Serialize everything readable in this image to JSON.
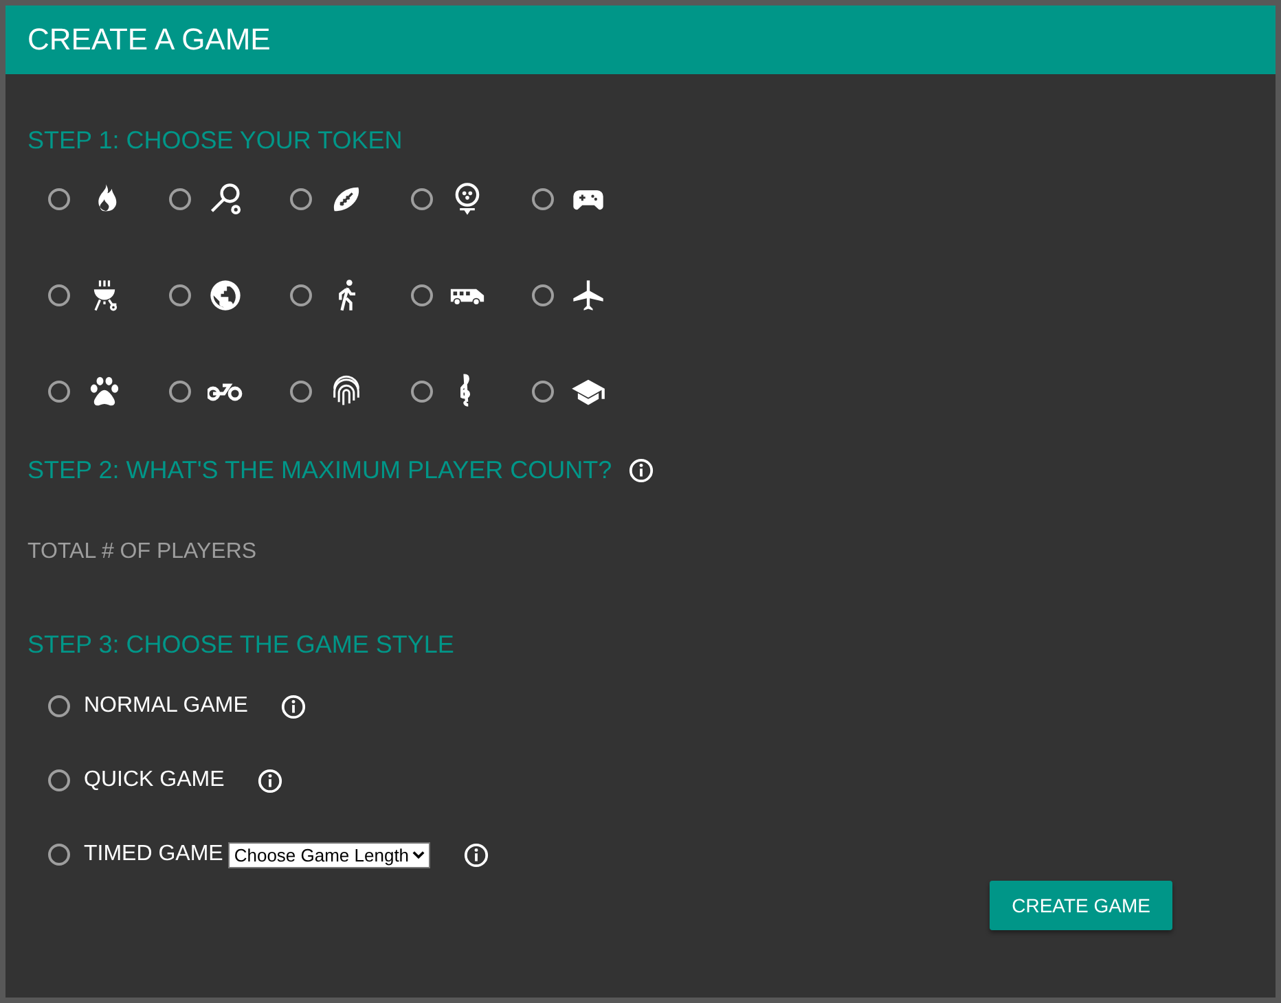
{
  "header": {
    "title": "CREATE A GAME"
  },
  "step1": {
    "title": "STEP 1: CHOOSE YOUR TOKEN",
    "tokens": [
      {
        "kind": "fire",
        "selected": false
      },
      {
        "kind": "racket",
        "selected": false
      },
      {
        "kind": "football",
        "selected": false
      },
      {
        "kind": "golf",
        "selected": false
      },
      {
        "kind": "gamepad",
        "selected": false
      },
      {
        "kind": "grill",
        "selected": false
      },
      {
        "kind": "globe",
        "selected": false
      },
      {
        "kind": "walker",
        "selected": false
      },
      {
        "kind": "bus",
        "selected": false
      },
      {
        "kind": "plane",
        "selected": false
      },
      {
        "kind": "paw",
        "selected": false
      },
      {
        "kind": "bike",
        "selected": false
      },
      {
        "kind": "fingerprint",
        "selected": false
      },
      {
        "kind": "clef",
        "selected": false
      },
      {
        "kind": "cap",
        "selected": false
      }
    ]
  },
  "step2": {
    "title": "STEP 2: WHAT'S THE MAXIMUM PLAYER COUNT?",
    "field_label": "TOTAL # OF PLAYERS"
  },
  "step3": {
    "title": "STEP 3: CHOOSE THE GAME STYLE",
    "options": [
      {
        "label": "NORMAL GAME",
        "selected": false
      },
      {
        "label": "QUICK GAME",
        "selected": false
      },
      {
        "label": "TIMED GAME",
        "selected": false,
        "select": "Choose Game Length"
      }
    ]
  },
  "button": "CREATE GAME"
}
